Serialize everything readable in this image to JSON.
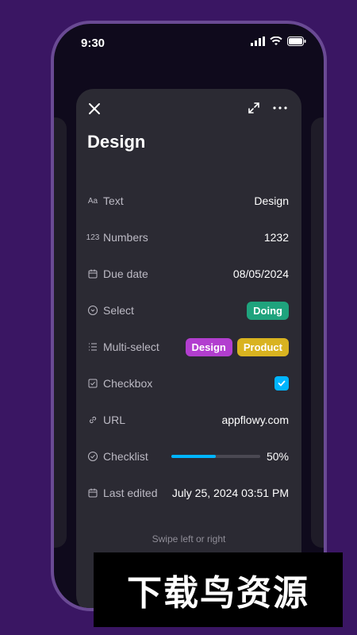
{
  "status_bar": {
    "time": "9:30"
  },
  "card": {
    "title": "Design",
    "rows": [
      {
        "label": "Text",
        "value": "Design",
        "icon": "text-icon"
      },
      {
        "label": "Numbers",
        "value": "1232",
        "icon": "numbers-icon"
      },
      {
        "label": "Due date",
        "value": "08/05/2024",
        "icon": "calendar-icon"
      },
      {
        "label": "Select",
        "value": "Doing",
        "icon": "select-icon"
      },
      {
        "label": "Multi-select",
        "values": [
          "Design",
          "Product"
        ],
        "icon": "multiselect-icon"
      },
      {
        "label": "Checkbox",
        "checked": true,
        "icon": "checkbox-icon"
      },
      {
        "label": "URL",
        "value": "appflowy.com",
        "icon": "link-icon"
      },
      {
        "label": "Checklist",
        "value": "50%",
        "progress": 0.5,
        "icon": "checklist-icon"
      },
      {
        "label": "Last edited",
        "value": "July 25, 2024 03:51 PM",
        "icon": "calendar-edit-icon"
      }
    ],
    "swipe_hint": "Swipe left or right"
  },
  "colors": {
    "background": "#3a1663",
    "card": "#2b2a33",
    "tag_doing": "#1fa37d",
    "tag_design": "#b23ecf",
    "tag_product": "#d9b320",
    "accent": "#00b5ff"
  },
  "watermark": {
    "text": "下载鸟资源"
  }
}
